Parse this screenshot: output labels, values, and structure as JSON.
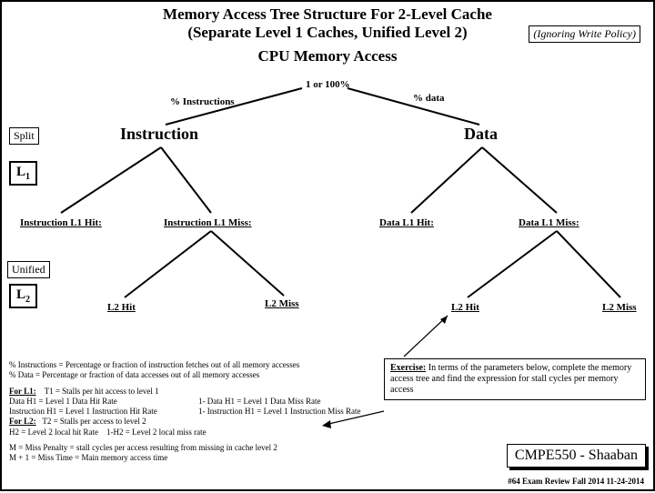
{
  "title": "Memory Access Tree Structure For 2-Level Cache",
  "subtitle": "(Separate Level 1 Caches, Unified Level 2)",
  "ignoring": "(Ignoring Write Policy)",
  "cpu": "CPU Memory  Access",
  "root": {
    "prob": "1 or 100%",
    "left": "% Instructions",
    "right": "% data"
  },
  "labels": {
    "split": "Split",
    "unified": "Unified",
    "L1": "L",
    "L1sub": "1",
    "L2": "L",
    "L2sub": "2"
  },
  "nodes": {
    "instruction": "Instruction",
    "data": "Data"
  },
  "leaves": {
    "il1hit": "Instruction L1 Hit:",
    "il1miss": "Instruction L1 Miss:",
    "dl1hit": "Data L1 Hit:",
    "dl1miss": "Data L1 Miss:",
    "l2hit_a": "L2 Hit",
    "l2miss_a": "L2  Miss",
    "l2hit_b": "L2 Hit",
    "l2miss_b": "L2  Miss"
  },
  "exercise": {
    "hdr": "Exercise:",
    "body": "In terms of the parameters below, complete the memory access tree and find the expression for stall cycles per memory access"
  },
  "defs": {
    "pct1": "% Instructions = Percentage or fraction of instruction fetches out of all memory accesses",
    "pct2": "% Data = Percentage or fraction of data accesses out of all memory accesses",
    "forL1": "For L1:",
    "t1": "T1 =  Stalls per hit access to level 1",
    "dh1": "Data H1  =  Level 1  Data Hit Rate",
    "ih1": "Instruction H1  =  Level 1  Instruction Hit Rate",
    "dmiss": "1- Data H1 = Level 1 Data Miss Rate",
    "imiss": "1- Instruction H1 = Level 1 Instruction Miss Rate",
    "forL2": "For L2:",
    "t2": "T2 = Stalls per access to level 2",
    "h2a": "H2 =  Level 2 local hit Rate",
    "h2b": "1-H2 =  Level 2 local miss rate",
    "m": "M = Miss Penalty = stall cycles per access resulting from missing in cache level 2",
    "m1": "M + 1 =  Miss Time = Main memory access time"
  },
  "course": "CMPE550 - Shaaban",
  "footer": "#64  Exam Review  Fall 2014   11-24-2014"
}
